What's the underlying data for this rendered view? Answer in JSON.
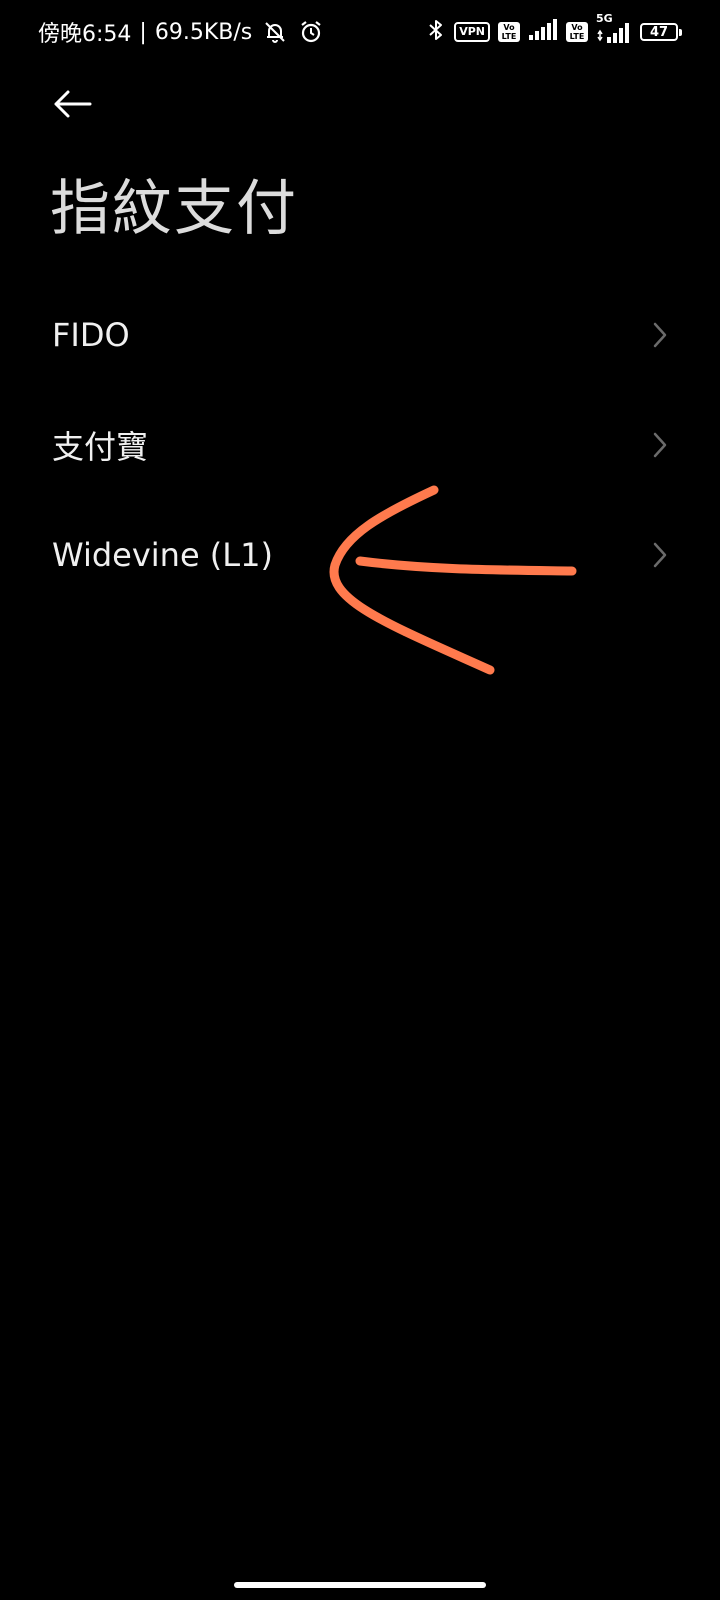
{
  "status_bar": {
    "time": "傍晚6:54",
    "separator": "|",
    "net_speed": "69.5KB/s",
    "left_icons": [
      "mute-bell-icon",
      "alarm-icon"
    ],
    "right_icons": [
      "bluetooth-icon",
      "vpn-badge",
      "volte-icon",
      "signal-icon",
      "volte-icon",
      "5g-signal-icon",
      "battery-icon"
    ],
    "vpn_label": "VPN",
    "volte_top": "Vo",
    "volte_bottom": "LTE",
    "network_type": "5G",
    "battery_level": "47"
  },
  "header": {
    "back_icon": "back-arrow-icon",
    "title": "指紋支付"
  },
  "menu": {
    "items": [
      {
        "label": "FIDO",
        "icon": "chevron-right-icon"
      },
      {
        "label": "支付寶",
        "icon": "chevron-right-icon"
      },
      {
        "label": "Widevine (L1)",
        "icon": "chevron-right-icon"
      }
    ]
  },
  "annotation": {
    "color": "#ff7a4d",
    "shape": "hand-drawn-arrow",
    "points_to": "Widevine (L1)"
  },
  "colors": {
    "background": "#000000",
    "text": "#f0f0f0",
    "chevron": "#6b6b6b"
  }
}
